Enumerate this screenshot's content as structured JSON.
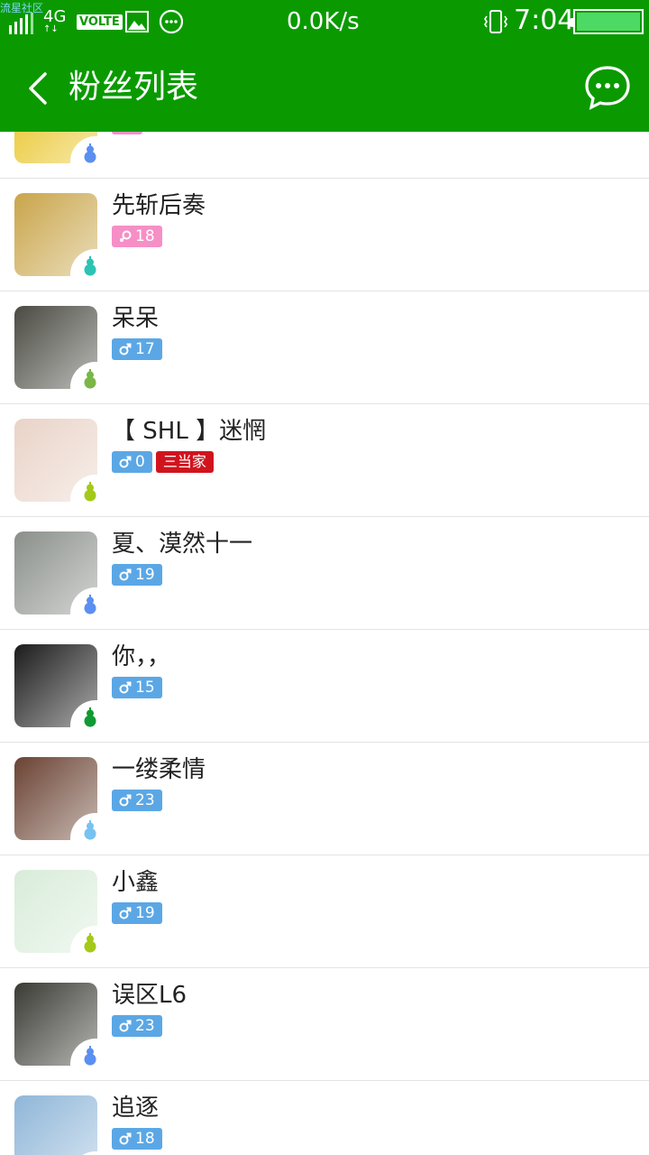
{
  "status_bar": {
    "watermark": "流星社区",
    "network": "4G",
    "volte": "VOLTE",
    "speed": "0.0K/s",
    "time": "7:04"
  },
  "header": {
    "title": "粉丝列表"
  },
  "fans": [
    {
      "name": "",
      "gender": "female",
      "age": "",
      "avatar_color": "#e8c21e",
      "gourd_color": "#5b8ff0"
    },
    {
      "name": "先斩后奏",
      "gender": "female",
      "age": "18",
      "avatar_color": "#c9a54a",
      "gourd_color": "#2bc4b4"
    },
    {
      "name": "呆呆",
      "gender": "male",
      "age": "17",
      "avatar_color": "#4a4a42",
      "gourd_color": "#7ab648"
    },
    {
      "name": "【 SHL 】迷惘",
      "gender": "male",
      "age": "0",
      "rank": "三当家",
      "avatar_color": "#e9d3c7",
      "gourd_color": "#a4c918"
    },
    {
      "name": "夏、漠然十一",
      "gender": "male",
      "age": "19",
      "avatar_color": "#8a8f8a",
      "gourd_color": "#5b8ff0"
    },
    {
      "name": "你，，",
      "gender": "male",
      "age": "15",
      "avatar_color": "#1b1b1b",
      "gourd_color": "#0f9b33"
    },
    {
      "name": "一缕柔情",
      "gender": "male",
      "age": "23",
      "avatar_color": "#6a4232",
      "gourd_color": "#76c2f0"
    },
    {
      "name": "小鑫",
      "gender": "male",
      "age": "19",
      "avatar_color": "#d8ecd9",
      "gourd_color": "#a4c918"
    },
    {
      "name": "误区L6",
      "gender": "male",
      "age": "23",
      "avatar_color": "#3a3a34",
      "gourd_color": "#5b8ff0"
    },
    {
      "name": "追逐",
      "gender": "male",
      "age": "18",
      "avatar_color": "#8fb6d8",
      "gourd_color": "#5b8ff0"
    }
  ]
}
